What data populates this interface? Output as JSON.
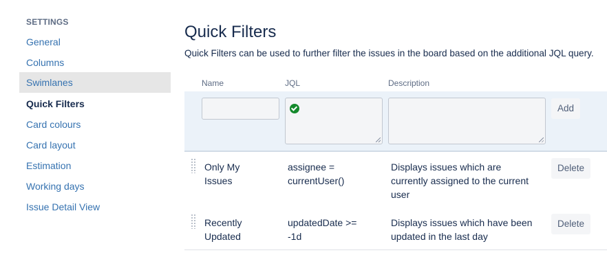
{
  "sidebar": {
    "heading": "SETTINGS",
    "items": [
      {
        "label": "General"
      },
      {
        "label": "Columns"
      },
      {
        "label": "Swimlanes"
      },
      {
        "label": "Quick Filters"
      },
      {
        "label": "Card colours"
      },
      {
        "label": "Card layout"
      },
      {
        "label": "Estimation"
      },
      {
        "label": "Working days"
      },
      {
        "label": "Issue Detail View"
      }
    ],
    "selected": "Quick Filters",
    "hovered": "Swimlanes"
  },
  "main": {
    "title": "Quick Filters",
    "description": "Quick Filters can be used to further filter the issues in the board based on the additional JQL query.",
    "columns": {
      "name": "Name",
      "jql": "JQL",
      "description": "Description"
    },
    "add_form": {
      "name_value": "",
      "jql_value": "",
      "description_value": "",
      "jql_status_icon": "check-circle-icon",
      "add_label": "Add"
    },
    "filters": [
      {
        "name": "Only My Issues",
        "jql": "assignee = currentUser()",
        "description": "Displays issues which are currently assigned to the current user",
        "delete_label": "Delete"
      },
      {
        "name": "Recently Updated",
        "jql": "updatedDate >= -1d",
        "description": "Displays issues which have been updated in the last day",
        "delete_label": "Delete"
      }
    ]
  },
  "colors": {
    "link": "#3572b0",
    "text": "#172b4d",
    "muted": "#5e6c84",
    "add_row_bg": "#ebf2f9",
    "valid_green": "#14892c"
  }
}
